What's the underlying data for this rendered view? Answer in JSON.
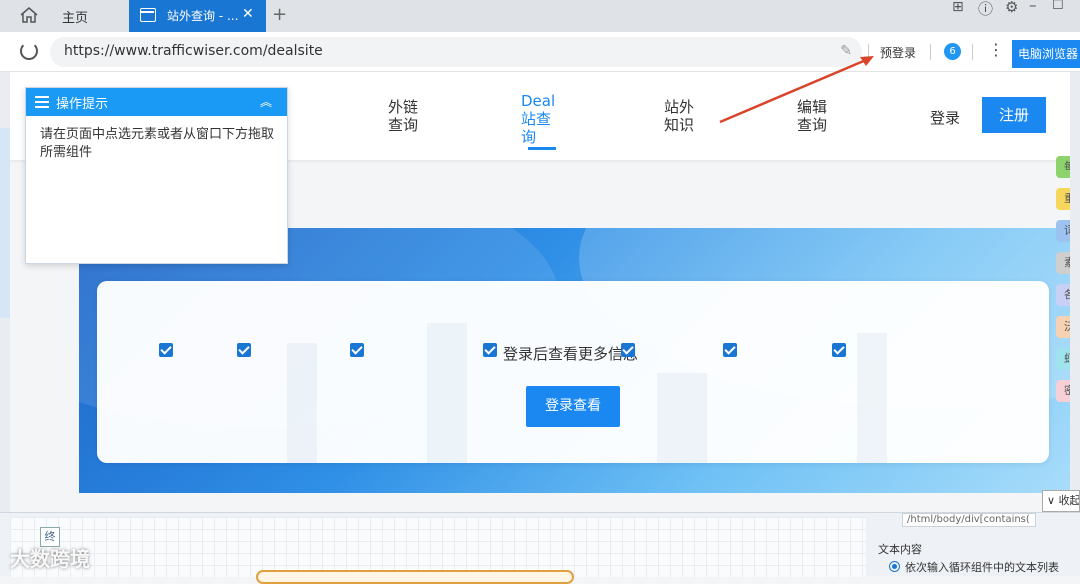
{
  "browser": {
    "home_tab_label": "主页",
    "active_tab_label": "站外查询 - ...",
    "url": "https://www.trafficwiser.com/dealsite",
    "prelogin_label": "预登录",
    "pc_browser_label": "电脑浏览器"
  },
  "site": {
    "nav": [
      {
        "line1": "外链",
        "line2": "查询",
        "line3": ""
      },
      {
        "line1": "Deal",
        "line2": "站查",
        "line3": "询"
      },
      {
        "line1": "站外",
        "line2": "知识",
        "line3": ""
      },
      {
        "line1": "编辑",
        "line2": "查询",
        "line3": ""
      }
    ],
    "login_label": "登录",
    "register_label": "注册",
    "card_message": "登录后查看更多信息",
    "view_button_label": "登录查看",
    "side_tags": [
      "每日",
      "重要",
      "词",
      "素",
      "各",
      "沃",
      "虾",
      "密"
    ]
  },
  "tip_panel": {
    "title": "操作提示",
    "body": "请在页面中点选元素或者从窗口下方拖取所需组件"
  },
  "bottom_panel": {
    "xpath_value": "/html/body/div[contains(",
    "text_content_label": "文本内容",
    "radio_option_label": "依次输入循环组件中的文本列表",
    "collapse_label": "收起",
    "tool_label": "终"
  },
  "watermark": "大数跨境",
  "colors": {
    "brand_blue": "#1a88f0",
    "tab_active": "#1976d2",
    "annotation_arrow": "#d9452b"
  }
}
